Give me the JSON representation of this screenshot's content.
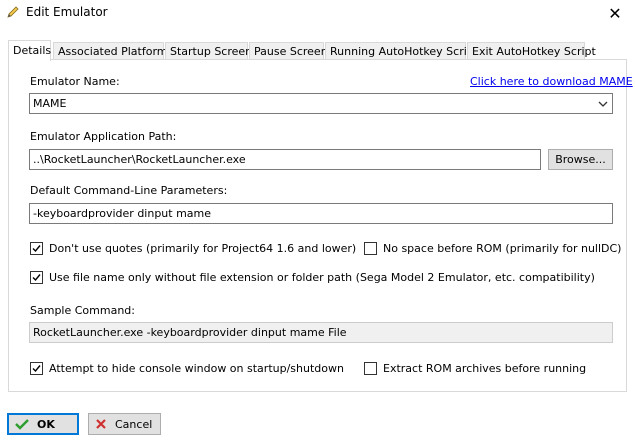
{
  "window": {
    "title": "Edit Emulator",
    "close_glyph": "✕"
  },
  "tabs": [
    {
      "label": "Details",
      "active": true
    },
    {
      "label": "Associated Platforms",
      "active": false
    },
    {
      "label": "Startup Screen",
      "active": false
    },
    {
      "label": "Pause Screen",
      "active": false
    },
    {
      "label": "Running AutoHotkey Script",
      "active": false
    },
    {
      "label": "Exit AutoHotkey Script",
      "active": false
    }
  ],
  "details": {
    "emulator_name_label": "Emulator Name:",
    "download_link": "Click here to download MAME",
    "emulator_name_value": "MAME",
    "app_path_label": "Emulator Application Path:",
    "app_path_value": "..\\RocketLauncher\\RocketLauncher.exe",
    "browse_label": "Browse...",
    "params_label": "Default Command-Line Parameters:",
    "params_value": "-keyboardprovider dinput mame",
    "cb_no_quotes": {
      "label": "Don't use quotes (primarily for Project64 1.6 and lower)",
      "checked": true
    },
    "cb_no_space": {
      "label": "No space before ROM (primarily for nullDC)",
      "checked": false
    },
    "cb_file_name_only": {
      "label": "Use file name only without file extension or folder path (Sega Model 2 Emulator, etc. compatibility)",
      "checked": true
    },
    "sample_label": "Sample Command:",
    "sample_value": "RocketLauncher.exe -keyboardprovider dinput mame File",
    "cb_hide_console": {
      "label": "Attempt to hide console window on startup/shutdown",
      "checked": true
    },
    "cb_extract_rom": {
      "label": "Extract ROM archives before running",
      "checked": false
    }
  },
  "footer": {
    "ok_label": "OK",
    "cancel_label": "Cancel"
  },
  "colors": {
    "accent": "#0078d7",
    "link": "#0000ee",
    "ok_check": "#2e9e2e",
    "cancel_x": "#d03030"
  }
}
